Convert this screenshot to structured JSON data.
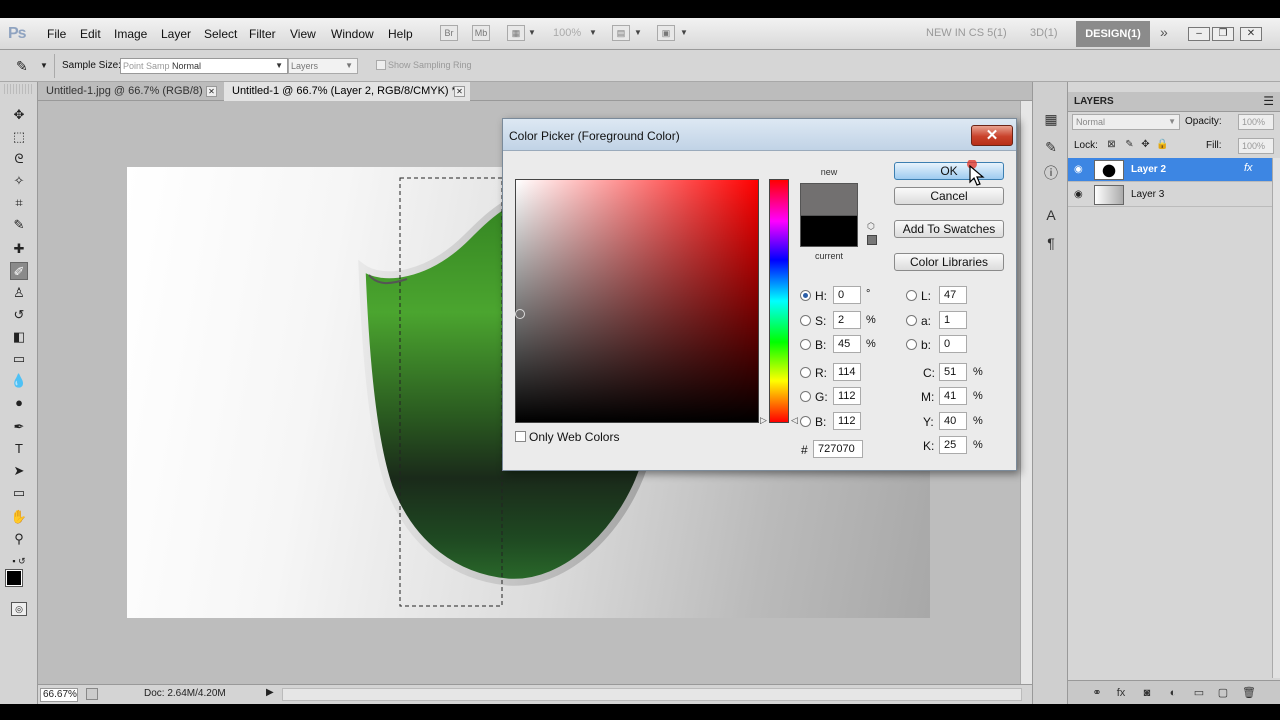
{
  "app": {
    "logo": "Ps"
  },
  "menu": [
    "File",
    "Edit",
    "Image",
    "Layer",
    "Select",
    "Filter",
    "View",
    "Window",
    "Help"
  ],
  "appbar": {
    "zoom": "100%",
    "workspaces": [
      "NEW IN CS 5(1)",
      "3D(1)",
      "DESIGN(1)"
    ],
    "more": "»",
    "window_buttons": [
      "–",
      "❐",
      "✕"
    ]
  },
  "options": {
    "sample_size_label": "Sample Size:",
    "sample_size_value": "Point Samp",
    "sample_size_mode": "Normal",
    "sample_layers": "Layers",
    "sampling_ring_label": "Show Sampling Ring"
  },
  "documents": [
    {
      "title": "Untitled-1.jpg @ 66.7% (RGB/8)",
      "active": false
    },
    {
      "title": "Untitled-1 @ 66.7% (Layer 2, RGB/8/CMYK) *",
      "active": true
    }
  ],
  "status": {
    "zoom": "66.67%",
    "doc_info": "Doc: 2.64M/4.20M"
  },
  "layers_panel": {
    "title": "LAYERS",
    "blend_mode": "Normal",
    "opacity_label": "Opacity:",
    "opacity_value": "100%",
    "lock_label": "Lock:",
    "fill_label": "Fill:",
    "fill_value": "100%",
    "layers": [
      {
        "name": "Layer 2",
        "selected": true,
        "fx": "fx"
      },
      {
        "name": "Layer 3",
        "selected": false,
        "fx": ""
      }
    ]
  },
  "color_picker": {
    "title": "Color Picker (Foreground Color)",
    "close": "✕",
    "new_label": "new",
    "current_label": "current",
    "new_color": "#727070",
    "current_color": "#000000",
    "buttons": {
      "ok": "OK",
      "cancel": "Cancel",
      "add_swatches": "Add To Swatches",
      "color_libraries": "Color Libraries"
    },
    "hsb": {
      "h_label": "H:",
      "h": "0",
      "h_unit": "°",
      "s_label": "S:",
      "s": "2",
      "s_unit": "%",
      "b_label": "B:",
      "b": "45",
      "b_unit": "%"
    },
    "rgb": {
      "r_label": "R:",
      "r": "114",
      "g_label": "G:",
      "g": "112",
      "b_label": "B:",
      "b": "112"
    },
    "lab": {
      "l_label": "L:",
      "l": "47",
      "a_label": "a:",
      "a": "1",
      "b_label": "b:",
      "b": "0"
    },
    "cmyk": {
      "c_label": "C:",
      "c": "51",
      "m_label": "M:",
      "m": "41",
      "y_label": "Y:",
      "y": "40",
      "k_label": "K:",
      "k": "25",
      "unit": "%"
    },
    "hex_label": "#",
    "hex": "727070",
    "only_web_colors": "Only Web Colors"
  }
}
